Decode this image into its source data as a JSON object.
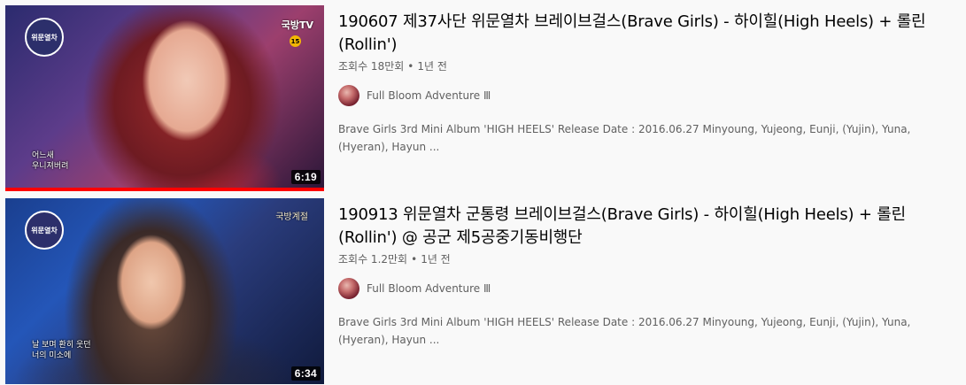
{
  "results": [
    {
      "thumbnail": {
        "logo_text": "위문열차",
        "channel_mark": "국방TV",
        "age_rating": "15",
        "caption_lines": [
          "어느새",
          "우니져버려"
        ],
        "duration": "6:19",
        "watched_progress": 1.0
      },
      "title": "190607 제37사단 위문열차 브레이브걸스(Brave Girls) - 하이힐(High Heels) + 롤린(Rollin')",
      "views": "조회수 18만회",
      "age": "1년 전",
      "channel": "Full Bloom Adventure Ⅲ",
      "description": "Brave Girls 3rd Mini Album 'HIGH HEELS' Release Date : 2016.06.27 Minyoung, Yujeong, Eunji, (Yujin), Yuna, (Hyeran), Hayun ..."
    },
    {
      "thumbnail": {
        "logo_text": "위문열차",
        "program_mark": "국방계절",
        "caption_lines": [
          "날 보며 환히 웃던",
          "너의 미소에"
        ],
        "duration": "6:34"
      },
      "title": "190913 위문열차 군통령 브레이브걸스(Brave Girls) - 하이힐(High Heels) + 롤린(Rollin') @ 공군 제5공중기동비행단",
      "views": "조회수 1.2만회",
      "age": "1년 전",
      "channel": "Full Bloom Adventure Ⅲ",
      "description": "Brave Girls 3rd Mini Album 'HIGH HEELS' Release Date : 2016.06.27 Minyoung, Yujeong, Eunji, (Yujin), Yuna, (Hyeran), Hayun ..."
    }
  ],
  "meta_separator": "•"
}
